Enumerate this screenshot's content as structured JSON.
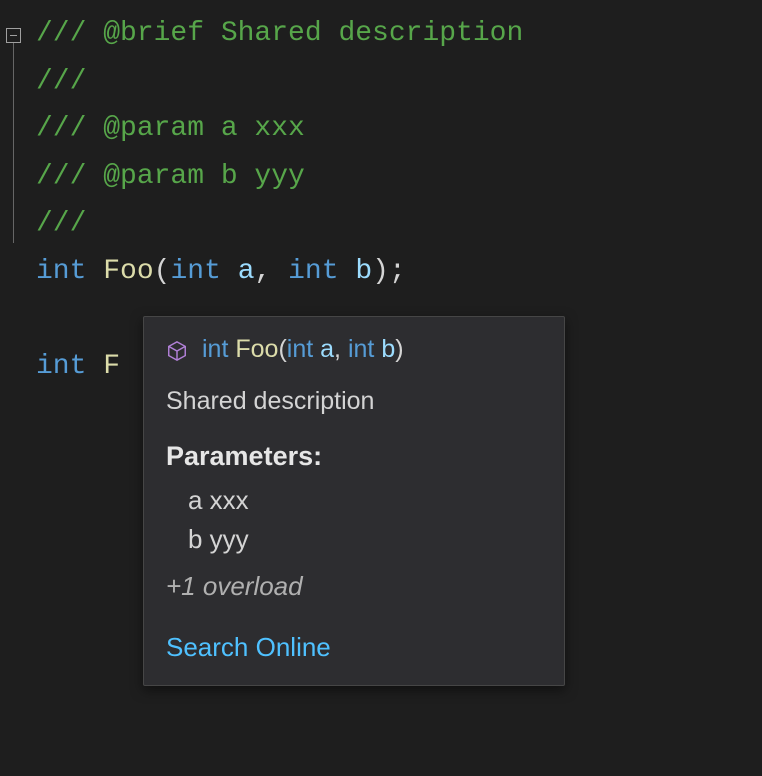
{
  "code": {
    "lines": [
      [
        {
          "cls": "tok-comment",
          "t": "/// @brief Shared description"
        }
      ],
      [
        {
          "cls": "tok-comment",
          "t": "///"
        }
      ],
      [
        {
          "cls": "tok-comment",
          "t": "/// @param a xxx"
        }
      ],
      [
        {
          "cls": "tok-comment",
          "t": "/// @param b yyy"
        }
      ],
      [
        {
          "cls": "tok-comment",
          "t": "///"
        }
      ],
      [
        {
          "cls": "tok-keyword",
          "t": "int"
        },
        {
          "cls": "tok-punc",
          "t": " "
        },
        {
          "cls": "tok-func",
          "t": "Foo"
        },
        {
          "cls": "tok-punc",
          "t": "("
        },
        {
          "cls": "tok-keyword",
          "t": "int"
        },
        {
          "cls": "tok-punc",
          "t": " "
        },
        {
          "cls": "tok-param",
          "t": "a"
        },
        {
          "cls": "tok-punc",
          "t": ", "
        },
        {
          "cls": "tok-keyword",
          "t": "int"
        },
        {
          "cls": "tok-punc",
          "t": " "
        },
        {
          "cls": "tok-param",
          "t": "b"
        },
        {
          "cls": "tok-punc",
          "t": ");"
        }
      ],
      [
        {
          "cls": "tok-punc",
          "t": " "
        }
      ],
      [
        {
          "cls": "tok-keyword",
          "t": "int"
        },
        {
          "cls": "tok-punc",
          "t": " "
        },
        {
          "cls": "tok-func",
          "t": "F"
        }
      ]
    ]
  },
  "tooltip": {
    "icon": "cube-icon",
    "icon_color": "#b180d7",
    "signature": {
      "ret_kw": "int",
      "fn": "Foo",
      "open": "(",
      "p1_kw": "int",
      "p1_nm": "a",
      "sep": ", ",
      "p2_kw": "int",
      "p2_nm": "b",
      "close": ")"
    },
    "description": "Shared description",
    "parameters_header": "Parameters:",
    "parameters": [
      {
        "name": "a",
        "desc": "xxx"
      },
      {
        "name": "b",
        "desc": "yyy"
      }
    ],
    "overload_text": "+1 overload",
    "search_link": "Search Online"
  }
}
